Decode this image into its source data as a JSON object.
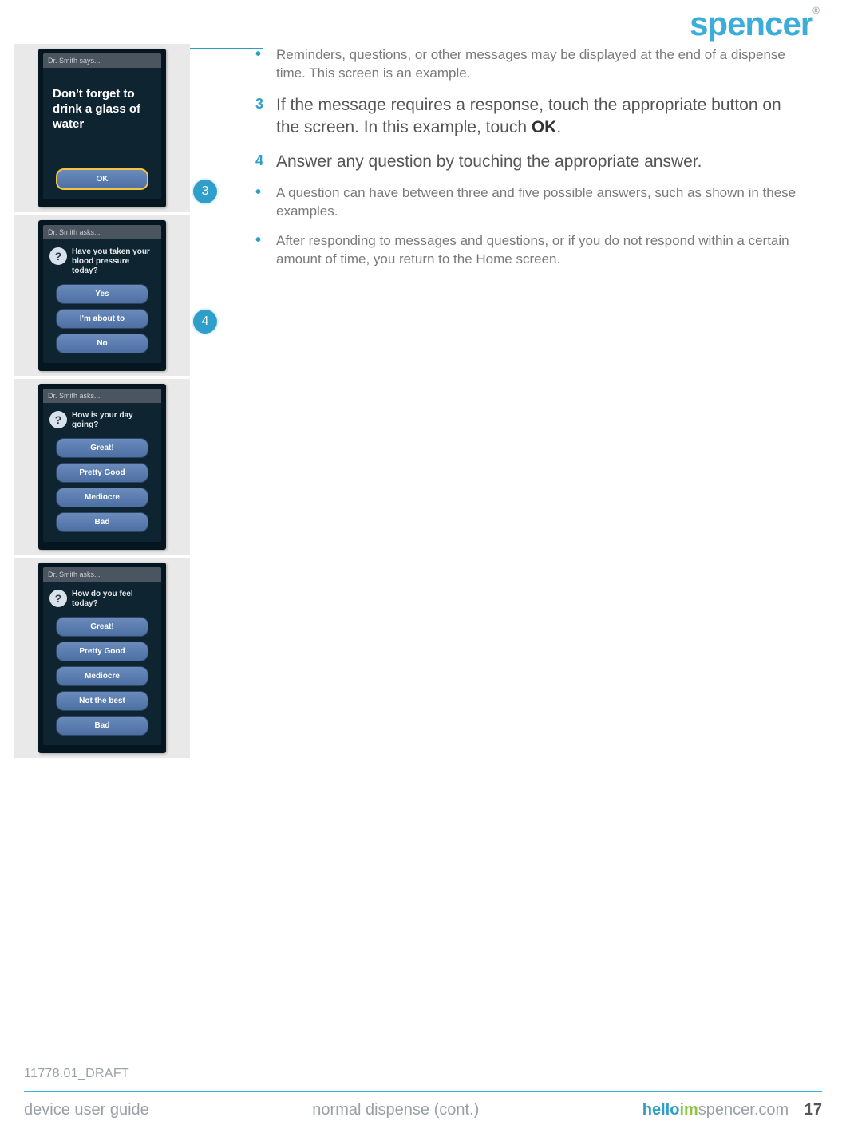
{
  "brand": {
    "name": "spencer",
    "reg": "®"
  },
  "callouts": {
    "c3": "3",
    "c4": "4"
  },
  "screens": {
    "s1": {
      "header": "Dr. Smith says...",
      "message": "Don't forget to drink a glass of water",
      "buttons": [
        "OK"
      ]
    },
    "s2": {
      "header": "Dr. Smith asks...",
      "question": "Have you taken your blood pressure today?",
      "buttons": [
        "Yes",
        "I'm about to",
        "No"
      ]
    },
    "s3": {
      "header": "Dr. Smith asks...",
      "question": "How is your day going?",
      "buttons": [
        "Great!",
        "Pretty Good",
        "Mediocre",
        "Bad"
      ]
    },
    "s4": {
      "header": "Dr. Smith asks...",
      "question": "How do you feel today?",
      "buttons": [
        "Great!",
        "Pretty Good",
        "Mediocre",
        "Not the best",
        "Bad"
      ]
    }
  },
  "body": {
    "b1": "Reminders, questions, or other messages may be displayed at the end of a dispense time. This screen is an example.",
    "n3": "3",
    "s3a": "If the message requires a response, touch the appropriate button on the screen. In this example, touch ",
    "s3b": "OK",
    "s3c": ".",
    "n4": "4",
    "s4": "Answer any question by touching the appropriate answer.",
    "b2": "A question can have between three and five possible answers, such as shown in these examples.",
    "b3": "After responding to messages and questions, or if you do not respond within a certain amount of time, you return to the Home screen."
  },
  "footer": {
    "draft": "11778.01_DRAFT",
    "left": "device user guide",
    "center": "normal dispense (cont.)",
    "url_h": "hello",
    "url_i": "im",
    "url_rest": "spencer.com",
    "page": "17"
  }
}
